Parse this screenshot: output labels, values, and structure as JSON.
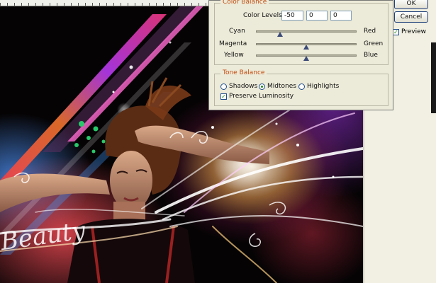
{
  "dialog": {
    "color_balance_title": "Color Balance",
    "color_levels_label": "Color Levels:",
    "color_levels": [
      "-50",
      "0",
      "0"
    ],
    "sliders": [
      {
        "left": "Cyan",
        "right": "Red",
        "value": -50
      },
      {
        "left": "Magenta",
        "right": "Green",
        "value": 0
      },
      {
        "left": "Yellow",
        "right": "Blue",
        "value": 0
      }
    ],
    "tone_balance_title": "Tone Balance",
    "tones": [
      "Shadows",
      "Midtones",
      "Highlights"
    ],
    "selected_tone": "Midtones",
    "preserve_luminosity_label": "Preserve Luminosity",
    "preserve_luminosity_checked": true
  },
  "buttons": {
    "ok_label": "OK",
    "cancel_label": "Cancel",
    "preview_label": "Preview",
    "preview_checked": true
  },
  "canvas": {
    "artwork_text": "Beauty",
    "accent_colors": [
      "#ff3b8a",
      "#28c86a",
      "#ffb347",
      "#7a3cff",
      "#ff4040"
    ]
  }
}
